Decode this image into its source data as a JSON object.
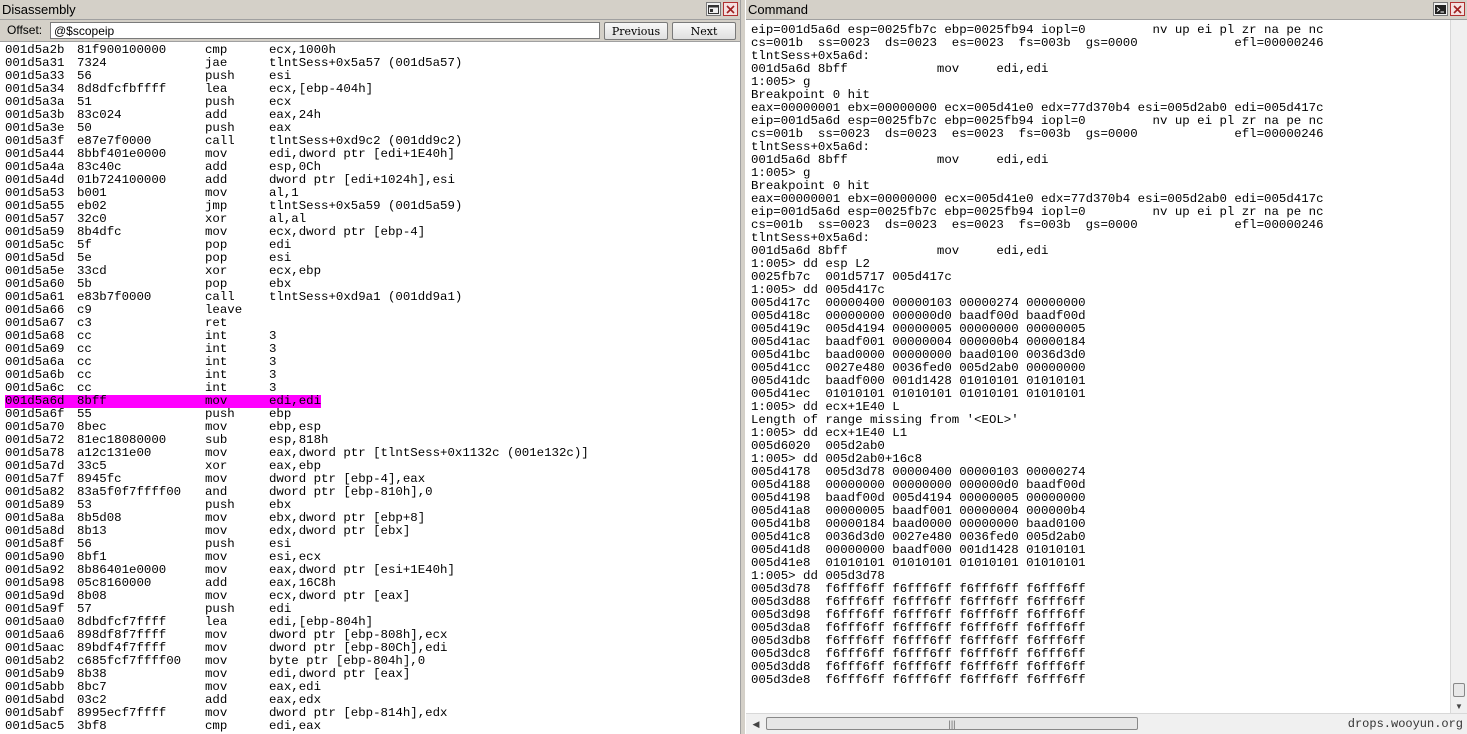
{
  "disassembly": {
    "title": "Disassembly",
    "offset_label": "Offset:",
    "offset_value": "@$scopeip",
    "prev_label": "Previous",
    "next_label": "Next",
    "highlight_color": "#ff00ff",
    "highlighted_index": 27,
    "lines": [
      [
        "001d5a2b",
        "81f900100000",
        "cmp",
        "ecx,1000h"
      ],
      [
        "001d5a31",
        "7324",
        "jae",
        "tlntSess+0x5a57 (001d5a57)"
      ],
      [
        "001d5a33",
        "56",
        "push",
        "esi"
      ],
      [
        "001d5a34",
        "8d8dfcfbffff",
        "lea",
        "ecx,[ebp-404h]"
      ],
      [
        "001d5a3a",
        "51",
        "push",
        "ecx"
      ],
      [
        "001d5a3b",
        "83c024",
        "add",
        "eax,24h"
      ],
      [
        "001d5a3e",
        "50",
        "push",
        "eax"
      ],
      [
        "001d5a3f",
        "e87e7f0000",
        "call",
        "tlntSess+0xd9c2 (001dd9c2)"
      ],
      [
        "001d5a44",
        "8bbf401e0000",
        "mov",
        "edi,dword ptr [edi+1E40h]"
      ],
      [
        "001d5a4a",
        "83c40c",
        "add",
        "esp,0Ch"
      ],
      [
        "001d5a4d",
        "01b724100000",
        "add",
        "dword ptr [edi+1024h],esi"
      ],
      [
        "001d5a53",
        "b001",
        "mov",
        "al,1"
      ],
      [
        "001d5a55",
        "eb02",
        "jmp",
        "tlntSess+0x5a59 (001d5a59)"
      ],
      [
        "001d5a57",
        "32c0",
        "xor",
        "al,al"
      ],
      [
        "001d5a59",
        "8b4dfc",
        "mov",
        "ecx,dword ptr [ebp-4]"
      ],
      [
        "001d5a5c",
        "5f",
        "pop",
        "edi"
      ],
      [
        "001d5a5d",
        "5e",
        "pop",
        "esi"
      ],
      [
        "001d5a5e",
        "33cd",
        "xor",
        "ecx,ebp"
      ],
      [
        "001d5a60",
        "5b",
        "pop",
        "ebx"
      ],
      [
        "001d5a61",
        "e83b7f0000",
        "call",
        "tlntSess+0xd9a1 (001dd9a1)"
      ],
      [
        "001d5a66",
        "c9",
        "leave",
        ""
      ],
      [
        "001d5a67",
        "c3",
        "ret",
        ""
      ],
      [
        "001d5a68",
        "cc",
        "int",
        "3"
      ],
      [
        "001d5a69",
        "cc",
        "int",
        "3"
      ],
      [
        "001d5a6a",
        "cc",
        "int",
        "3"
      ],
      [
        "001d5a6b",
        "cc",
        "int",
        "3"
      ],
      [
        "001d5a6c",
        "cc",
        "int",
        "3"
      ],
      [
        "001d5a6d",
        "8bff",
        "mov",
        "edi,edi"
      ],
      [
        "001d5a6f",
        "55",
        "push",
        "ebp"
      ],
      [
        "001d5a70",
        "8bec",
        "mov",
        "ebp,esp"
      ],
      [
        "001d5a72",
        "81ec18080000",
        "sub",
        "esp,818h"
      ],
      [
        "001d5a78",
        "a12c131e00",
        "mov",
        "eax,dword ptr [tlntSess+0x1132c (001e132c)]"
      ],
      [
        "001d5a7d",
        "33c5",
        "xor",
        "eax,ebp"
      ],
      [
        "001d5a7f",
        "8945fc",
        "mov",
        "dword ptr [ebp-4],eax"
      ],
      [
        "001d5a82",
        "83a5f0f7ffff00",
        "and",
        "dword ptr [ebp-810h],0"
      ],
      [
        "001d5a89",
        "53",
        "push",
        "ebx"
      ],
      [
        "001d5a8a",
        "8b5d08",
        "mov",
        "ebx,dword ptr [ebp+8]"
      ],
      [
        "001d5a8d",
        "8b13",
        "mov",
        "edx,dword ptr [ebx]"
      ],
      [
        "001d5a8f",
        "56",
        "push",
        "esi"
      ],
      [
        "001d5a90",
        "8bf1",
        "mov",
        "esi,ecx"
      ],
      [
        "001d5a92",
        "8b86401e0000",
        "mov",
        "eax,dword ptr [esi+1E40h]"
      ],
      [
        "001d5a98",
        "05c8160000",
        "add",
        "eax,16C8h"
      ],
      [
        "001d5a9d",
        "8b08",
        "mov",
        "ecx,dword ptr [eax]"
      ],
      [
        "001d5a9f",
        "57",
        "push",
        "edi"
      ],
      [
        "001d5aa0",
        "8dbdfcf7ffff",
        "lea",
        "edi,[ebp-804h]"
      ],
      [
        "001d5aa6",
        "898df8f7ffff",
        "mov",
        "dword ptr [ebp-808h],ecx"
      ],
      [
        "001d5aac",
        "89bdf4f7ffff",
        "mov",
        "dword ptr [ebp-80Ch],edi"
      ],
      [
        "001d5ab2",
        "c685fcf7ffff00",
        "mov",
        "byte ptr [ebp-804h],0"
      ],
      [
        "001d5ab9",
        "8b38",
        "mov",
        "edi,dword ptr [eax]"
      ],
      [
        "001d5abb",
        "8bc7",
        "mov",
        "eax,edi"
      ],
      [
        "001d5abd",
        "03c2",
        "add",
        "eax,edx"
      ],
      [
        "001d5abf",
        "8995ecf7ffff",
        "mov",
        "dword ptr [ebp-814h],edx"
      ],
      [
        "001d5ac5",
        "3bf8",
        "cmp",
        "edi,eax"
      ]
    ]
  },
  "command": {
    "title": "Command",
    "watermark": "drops.wooyun.org",
    "lines": [
      "eip=001d5a6d esp=0025fb7c ebp=0025fb94 iopl=0         nv up ei pl zr na pe nc",
      "cs=001b  ss=0023  ds=0023  es=0023  fs=003b  gs=0000             efl=00000246",
      "tlntSess+0x5a6d:",
      "001d5a6d 8bff            mov     edi,edi",
      "1:005> g",
      "Breakpoint 0 hit",
      "eax=00000001 ebx=00000000 ecx=005d41e0 edx=77d370b4 esi=005d2ab0 edi=005d417c",
      "eip=001d5a6d esp=0025fb7c ebp=0025fb94 iopl=0         nv up ei pl zr na pe nc",
      "cs=001b  ss=0023  ds=0023  es=0023  fs=003b  gs=0000             efl=00000246",
      "tlntSess+0x5a6d:",
      "001d5a6d 8bff            mov     edi,edi",
      "1:005> g",
      "Breakpoint 0 hit",
      "eax=00000001 ebx=00000000 ecx=005d41e0 edx=77d370b4 esi=005d2ab0 edi=005d417c",
      "eip=001d5a6d esp=0025fb7c ebp=0025fb94 iopl=0         nv up ei pl zr na pe nc",
      "cs=001b  ss=0023  ds=0023  es=0023  fs=003b  gs=0000             efl=00000246",
      "tlntSess+0x5a6d:",
      "001d5a6d 8bff            mov     edi,edi",
      "1:005> dd esp L2",
      "0025fb7c  001d5717 005d417c",
      "1:005> dd 005d417c",
      "005d417c  00000400 00000103 00000274 00000000",
      "005d418c  00000000 000000d0 baadf00d baadf00d",
      "005d419c  005d4194 00000005 00000000 00000005",
      "005d41ac  baadf001 00000004 000000b4 00000184",
      "005d41bc  baad0000 00000000 baad0100 0036d3d0",
      "005d41cc  0027e480 0036fed0 005d2ab0 00000000",
      "005d41dc  baadf000 001d1428 01010101 01010101",
      "005d41ec  01010101 01010101 01010101 01010101",
      "1:005> dd ecx+1E40 L",
      "Length of range missing from '<EOL>'",
      "1:005> dd ecx+1E40 L1",
      "005d6020  005d2ab0",
      "1:005> dd 005d2ab0+16c8",
      "005d4178  005d3d78 00000400 00000103 00000274",
      "005d4188  00000000 00000000 000000d0 baadf00d",
      "005d4198  baadf00d 005d4194 00000005 00000000",
      "005d41a8  00000005 baadf001 00000004 000000b4",
      "005d41b8  00000184 baad0000 00000000 baad0100",
      "005d41c8  0036d3d0 0027e480 0036fed0 005d2ab0",
      "005d41d8  00000000 baadf000 001d1428 01010101",
      "005d41e8  01010101 01010101 01010101 01010101",
      "1:005> dd 005d3d78",
      "005d3d78  f6fff6ff f6fff6ff f6fff6ff f6fff6ff",
      "005d3d88  f6fff6ff f6fff6ff f6fff6ff f6fff6ff",
      "005d3d98  f6fff6ff f6fff6ff f6fff6ff f6fff6ff",
      "005d3da8  f6fff6ff f6fff6ff f6fff6ff f6fff6ff",
      "005d3db8  f6fff6ff f6fff6ff f6fff6ff f6fff6ff",
      "005d3dc8  f6fff6ff f6fff6ff f6fff6ff f6fff6ff",
      "005d3dd8  f6fff6ff f6fff6ff f6fff6ff f6fff6ff",
      "005d3de8  f6fff6ff f6fff6ff f6fff6ff f6fff6ff"
    ]
  }
}
